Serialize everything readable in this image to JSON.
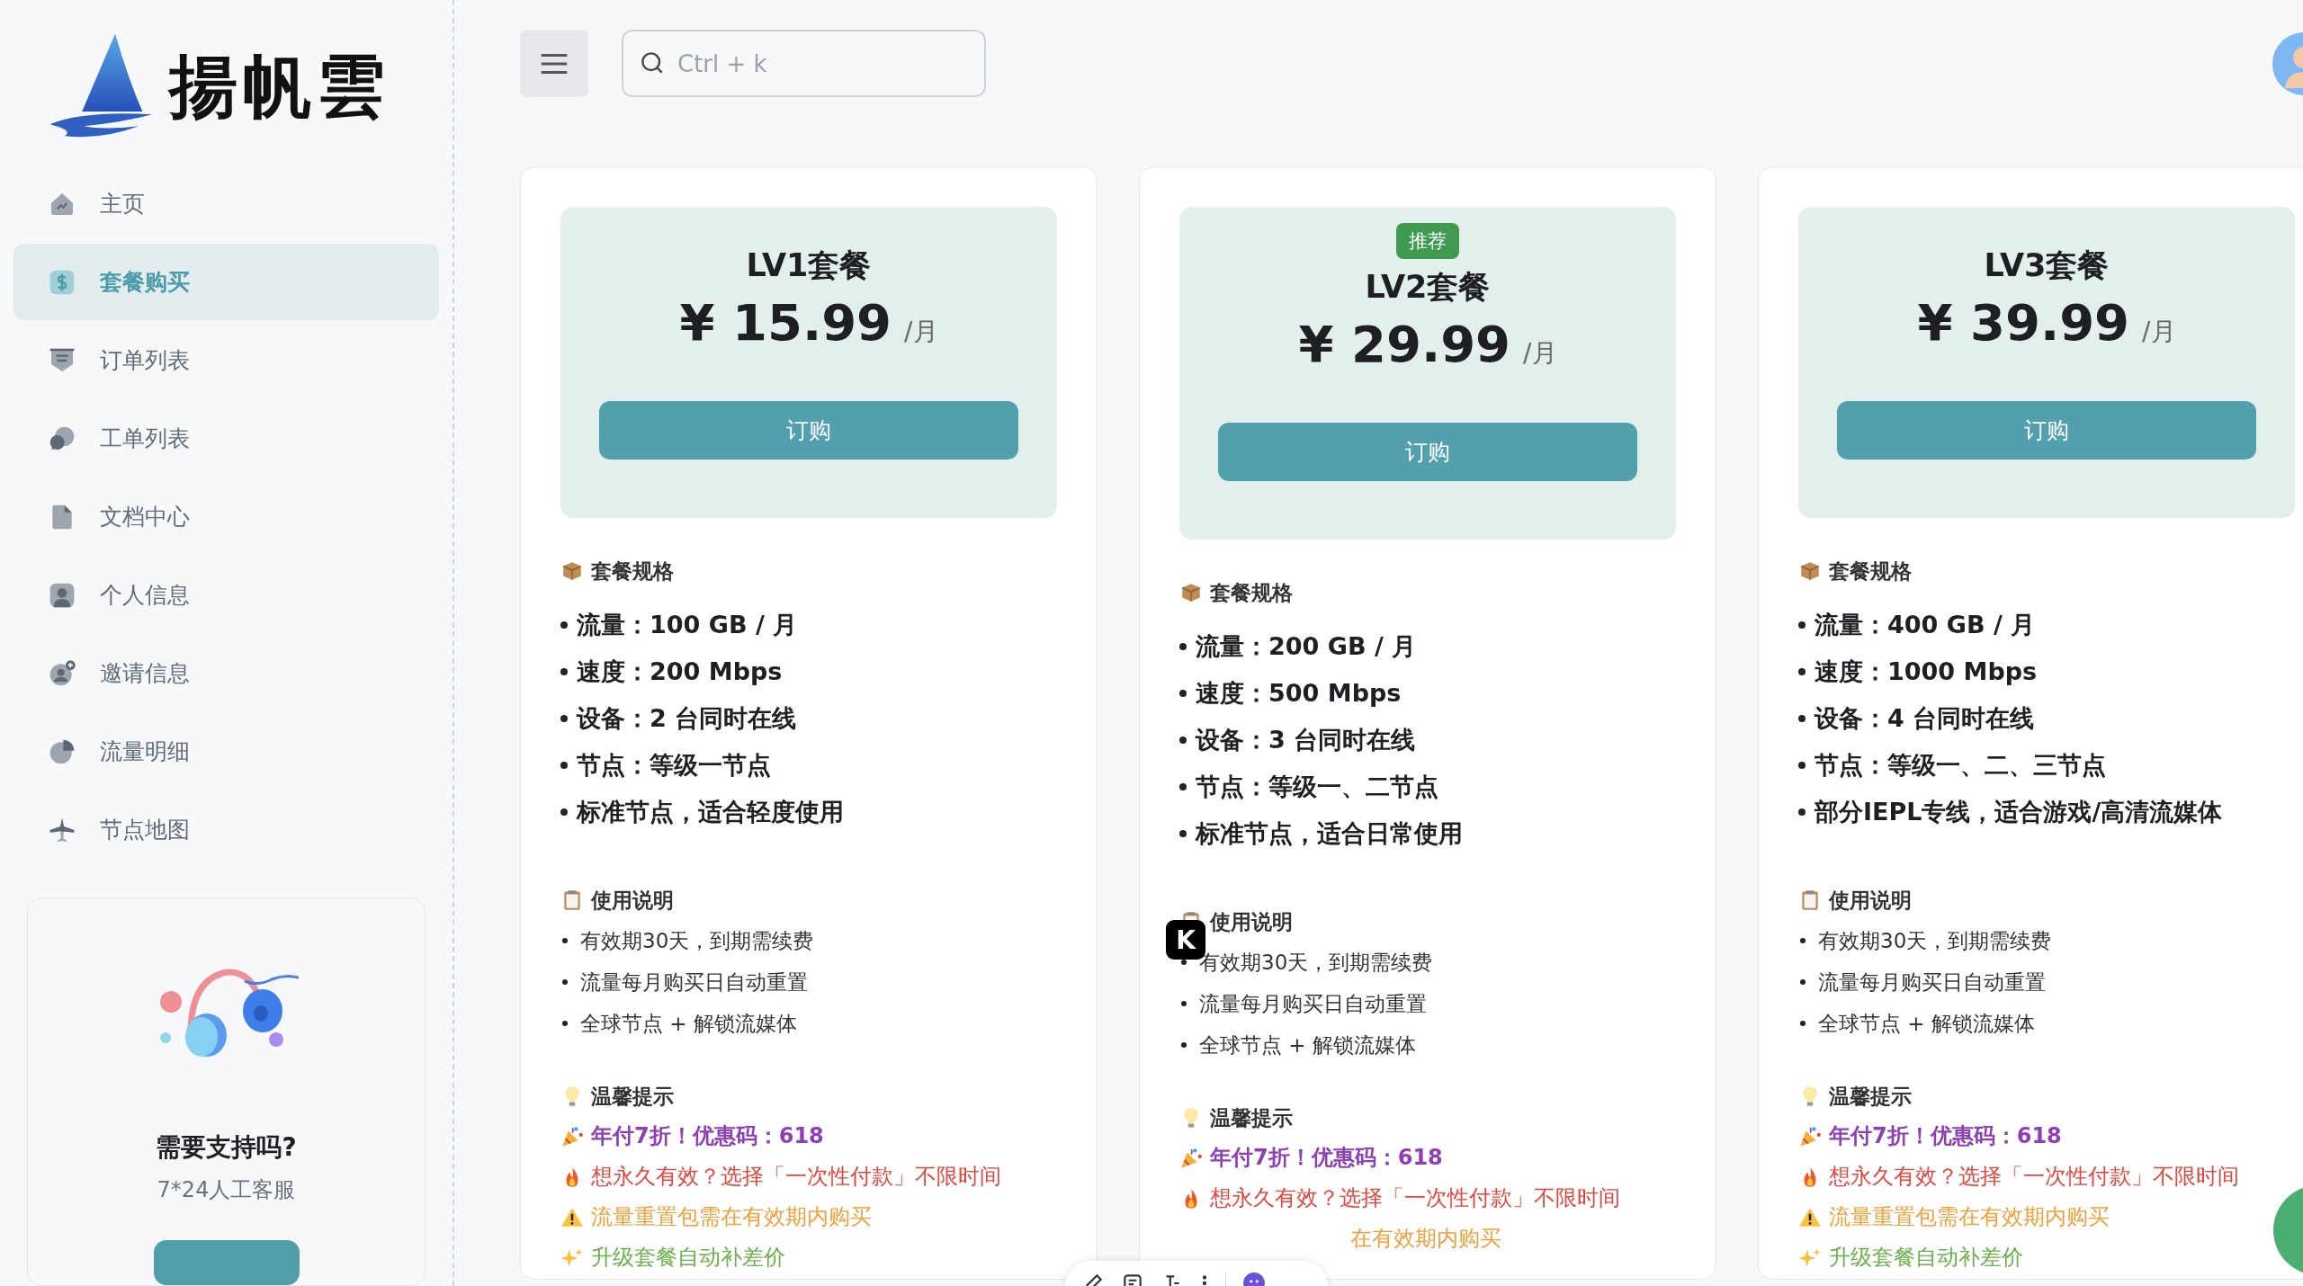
{
  "logo": {
    "text": "揚帆雲"
  },
  "sidebar": {
    "items": [
      {
        "label": "主页",
        "selected": false
      },
      {
        "label": "套餐购买",
        "selected": true
      },
      {
        "label": "订单列表",
        "selected": false
      },
      {
        "label": "工单列表",
        "selected": false
      },
      {
        "label": "文档中心",
        "selected": false
      },
      {
        "label": "个人信息",
        "selected": false
      },
      {
        "label": "邀请信息",
        "selected": false
      },
      {
        "label": "流量明细",
        "selected": false
      },
      {
        "label": "节点地图",
        "selected": false
      }
    ],
    "support": {
      "title": "需要支持吗?",
      "subtitle": "7*24人工客服"
    }
  },
  "search": {
    "placeholder": "Ctrl + k"
  },
  "plans": [
    {
      "name": "LV1套餐",
      "recommended": false,
      "price": "¥ 15.99",
      "unit": "/月",
      "button": "订购",
      "spec_title": "套餐规格",
      "specs": [
        {
          "label": "流量：",
          "value": "100 GB / 月"
        },
        {
          "label": "速度：",
          "value": "200 Mbps"
        },
        {
          "label": "设备：",
          "value": "2 台同时在线"
        },
        {
          "label": "节点：",
          "value": "等级一节点"
        },
        {
          "value": "标准节点，适合轻度使用"
        }
      ],
      "usage_title": "使用说明",
      "usage": [
        "有效期30天，到期需续费",
        "流量每月购买日自动重置",
        "全球节点 + 解锁流媒体"
      ],
      "tips_title": "温馨提示",
      "tips": [
        {
          "kind": "promo",
          "text": "年付7折！优惠码：618"
        },
        {
          "kind": "hot",
          "text": "想永久有效？选择「一次性付款」不限时间"
        },
        {
          "kind": "warning",
          "text": "流量重置包需在有效期内购买"
        },
        {
          "kind": "upgrade",
          "text": "升级套餐自动补差价"
        }
      ]
    },
    {
      "name": "LV2套餐",
      "recommended": true,
      "badge": "推荐",
      "price": "¥ 29.99",
      "unit": "/月",
      "button": "订购",
      "spec_title": "套餐规格",
      "specs": [
        {
          "label": "流量：",
          "value": "200 GB / 月"
        },
        {
          "label": "速度：",
          "value": "500 Mbps"
        },
        {
          "label": "设备：",
          "value": "3 台同时在线"
        },
        {
          "label": "节点：",
          "value": "等级一、二节点"
        },
        {
          "value": "标准节点，适合日常使用"
        }
      ],
      "usage_title": "使用说明",
      "usage": [
        "有效期30天，到期需续费",
        "流量每月购买日自动重置",
        "全球节点 + 解锁流媒体"
      ],
      "tips_title": "温馨提示",
      "tips": [
        {
          "kind": "promo",
          "text": "年付7折！优惠码：618"
        },
        {
          "kind": "hot",
          "text": "想永久有效？选择「一次性付款」不限时间"
        },
        {
          "kind": "cut",
          "text": "在有效期内购买"
        }
      ]
    },
    {
      "name": "LV3套餐",
      "recommended": false,
      "price": "¥ 39.99",
      "unit": "/月",
      "button": "订购",
      "spec_title": "套餐规格",
      "specs": [
        {
          "label": "流量：",
          "value": "400 GB / 月"
        },
        {
          "label": "速度：",
          "value": "1000 Mbps"
        },
        {
          "label": "设备：",
          "value": "4 台同时在线"
        },
        {
          "label": "节点：",
          "value": "等级一、二、三节点"
        },
        {
          "value": "部分IEPL专线，适合游戏/高清流媒体"
        }
      ],
      "usage_title": "使用说明",
      "usage": [
        "有效期30天，到期需续费",
        "流量每月购买日自动重置",
        "全球节点 + 解锁流媒体"
      ],
      "tips_title": "温馨提示",
      "tips": [
        {
          "kind": "promo",
          "text": "年付7折！优惠码：618"
        },
        {
          "kind": "hot",
          "text": "想永久有效？选择「一次性付款」不限时间"
        },
        {
          "kind": "warning",
          "text": "流量重置包需在有效期内购买"
        },
        {
          "kind": "upgrade",
          "text": "升级套餐自动补差价"
        }
      ]
    }
  ],
  "overlay_badge": {
    "label": "K"
  }
}
